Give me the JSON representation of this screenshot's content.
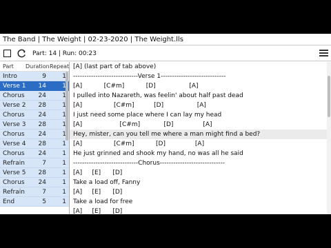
{
  "window": {
    "title": "The Band | The Weight | 02-23-2020 | The Weight.lls"
  },
  "toolbar": {
    "status": "Part: 14 | Run: 00:23"
  },
  "parts": {
    "headers": {
      "part": "Part",
      "duration": "Duration",
      "repeat": "Repeat"
    },
    "rows": [
      {
        "part": "Intro",
        "duration": "9",
        "repeat": "1"
      },
      {
        "part": "Verse 1",
        "duration": "14",
        "repeat": "1"
      },
      {
        "part": "Chorus",
        "duration": "24",
        "repeat": "1"
      },
      {
        "part": "Verse 2",
        "duration": "28",
        "repeat": "1"
      },
      {
        "part": "Chorus",
        "duration": "24",
        "repeat": "1"
      },
      {
        "part": "Verse 3",
        "duration": "28",
        "repeat": "1"
      },
      {
        "part": "Chorus",
        "duration": "24",
        "repeat": "1"
      },
      {
        "part": "Verse 4",
        "duration": "28",
        "repeat": "1"
      },
      {
        "part": "Chorus",
        "duration": "24",
        "repeat": "1"
      },
      {
        "part": "Refrain",
        "duration": "7",
        "repeat": "1"
      },
      {
        "part": "Verse 5",
        "duration": "28",
        "repeat": "1"
      },
      {
        "part": "Chorus",
        "duration": "24",
        "repeat": "1"
      },
      {
        "part": "Refrain",
        "duration": "7",
        "repeat": "1"
      },
      {
        "part": "End",
        "duration": "5",
        "repeat": "1"
      }
    ]
  },
  "lyrics": [
    "[A] (last part of tab above)",
    "-----------------------------Verse 1-----------------------------",
    "[A]           [C#m]           [D]                 [A]",
    "I pulled into Nazareth, was feelin' about half past dead",
    "[A]                [C#m]          [D]                 [A]",
    "I just need some place where I can lay my head",
    "[A]                   [C#m]            [D]               [A]",
    "Hey, mister, can you tell me where a man might find a bed?",
    "[A]                [C#m]           [D]               [A]",
    "He just grinned and shook my hand, no was all he said",
    "-----------------------------Chorus-----------------------------",
    "[A]     [E]      [D]",
    "Take a load off, Fanny",
    "[A]     [E]      [D]",
    "Take a load for free",
    "[A]     [E]      [D]"
  ]
}
